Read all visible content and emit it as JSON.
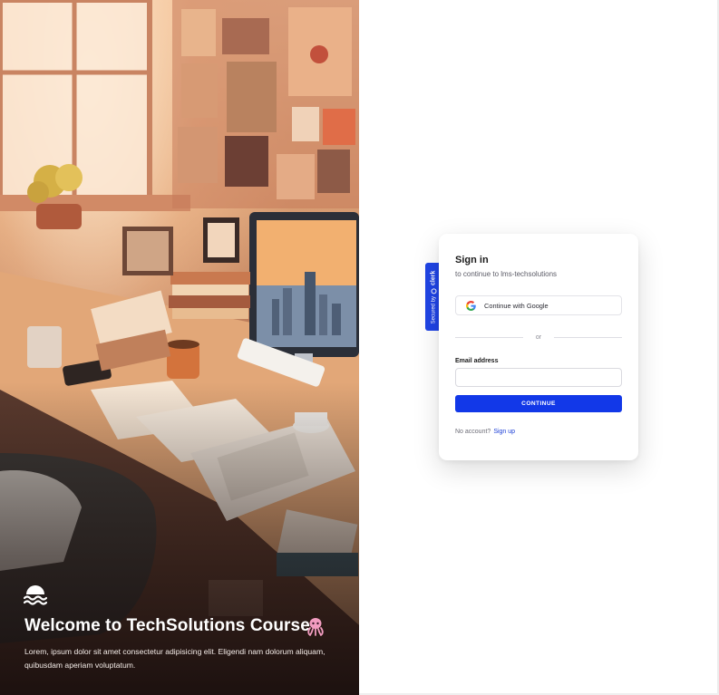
{
  "hero": {
    "title": "Welcome to TechSolutions Course",
    "emoji_icon": "octopus-icon",
    "logo_icon": "waves-logo-icon",
    "description": "Lorem, ipsum dolor sit amet consectetur adipisicing elit. Eligendi nam dolorum aliquam, quibusdam aperiam voluptatum."
  },
  "badge": {
    "prefix": "Secured by",
    "brand": "clerk",
    "icon": "clerk-logo-icon"
  },
  "signin": {
    "title": "Sign in",
    "subtitle": "to continue to lms-techsolutions",
    "google_label": "Continue with Google",
    "google_icon": "google-icon",
    "divider_text": "or",
    "email_label": "Email address",
    "email_value": "",
    "continue_label": "CONTINUE",
    "no_account_text": "No account?",
    "signup_label": "Sign up"
  },
  "colors": {
    "primary": "#1238e8",
    "badge": "#1f44e6",
    "link": "#1c3fd6"
  }
}
